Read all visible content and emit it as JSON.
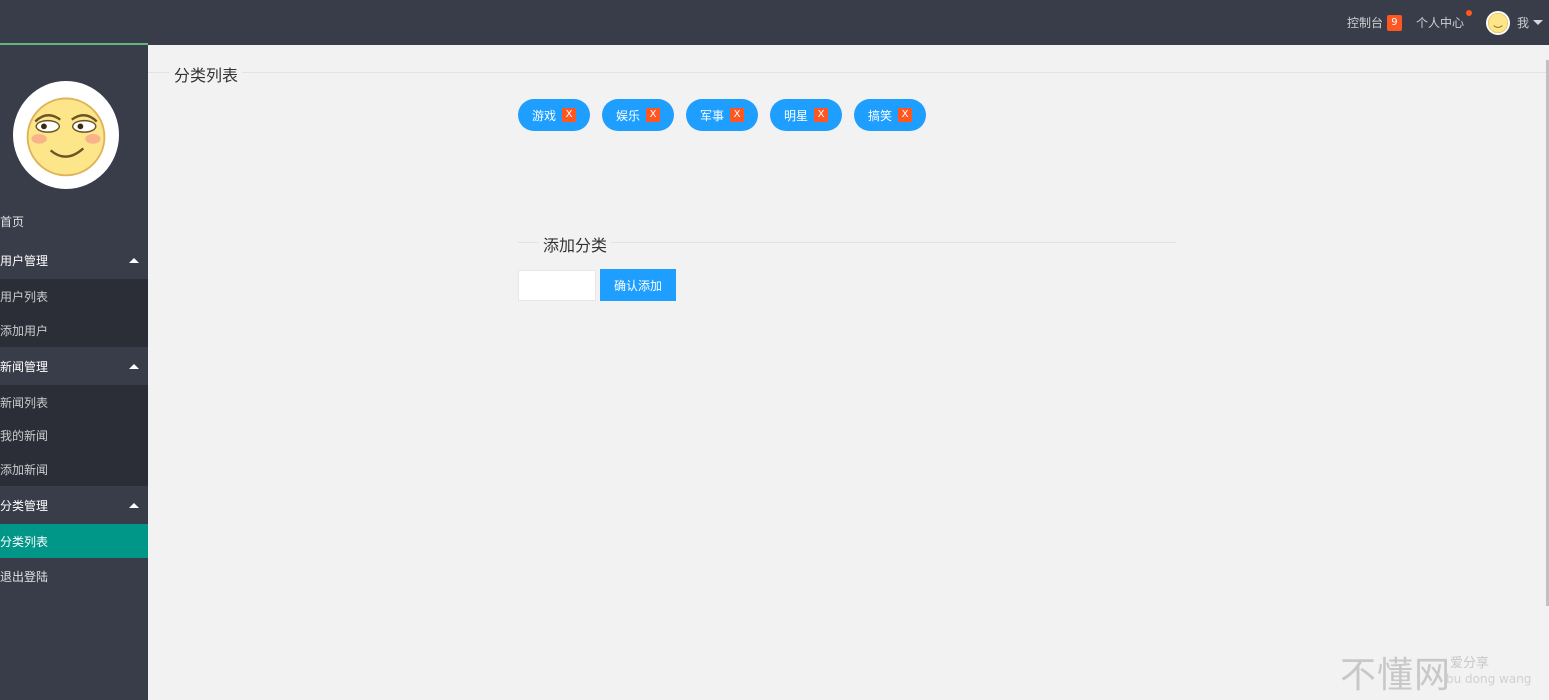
{
  "header": {
    "console_label": "控制台",
    "console_badge": "9",
    "personal_center_label": "个人中心",
    "user_label": "我"
  },
  "sidebar": {
    "items": [
      {
        "label": "首页",
        "kind": "item"
      },
      {
        "label": "用户管理",
        "kind": "group"
      },
      {
        "label": "用户列表",
        "kind": "sub"
      },
      {
        "label": "添加用户",
        "kind": "sub"
      },
      {
        "label": "新闻管理",
        "kind": "group"
      },
      {
        "label": "新闻列表",
        "kind": "sub"
      },
      {
        "label": "我的新闻",
        "kind": "sub"
      },
      {
        "label": "添加新闻",
        "kind": "sub"
      },
      {
        "label": "分类管理",
        "kind": "group"
      },
      {
        "label": "分类列表",
        "kind": "sub",
        "active": true
      },
      {
        "label": "退出登陆",
        "kind": "item"
      }
    ]
  },
  "main": {
    "list_title": "分类列表",
    "categories": [
      {
        "label": "游戏",
        "remove": "X"
      },
      {
        "label": "娱乐",
        "remove": "X"
      },
      {
        "label": "军事",
        "remove": "X"
      },
      {
        "label": "明星",
        "remove": "X"
      },
      {
        "label": "搞笑",
        "remove": "X"
      }
    ],
    "add_title": "添加分类",
    "input_value": "",
    "add_button": "确认添加"
  },
  "watermark": {
    "main": "不懂网",
    "sub": "爱分享",
    "sub2": "bu dong wang"
  },
  "colors": {
    "header_bg": "#393d49",
    "accent_green": "#5fb878",
    "active_teal": "#009688",
    "tag_blue": "#1e9fff",
    "badge_orange": "#ff5722"
  },
  "icons": {
    "avatar": "smiley-face-icon",
    "collapse": "caret-up-icon",
    "dropdown": "caret-down-icon"
  }
}
